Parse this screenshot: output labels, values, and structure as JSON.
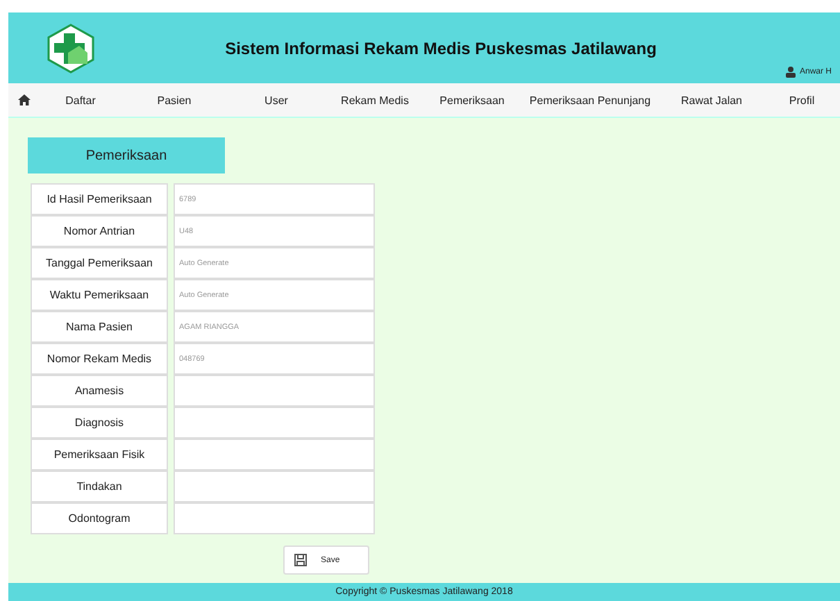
{
  "header": {
    "title": "Sistem Informasi Rekam Medis Puskesmas Jatilawang",
    "user": "Anwar H"
  },
  "nav": [
    "Daftar",
    "Pasien",
    "User",
    "Rekam Medis",
    "Pemeriksaan",
    "Pemeriksaan Penunjang",
    "Rawat Jalan",
    "Profil"
  ],
  "form": {
    "title": "Pemeriksaan",
    "fields": [
      {
        "label": "Id Hasil Pemeriksaan",
        "value": "6789"
      },
      {
        "label": "Nomor Antrian",
        "value": "U48"
      },
      {
        "label": "Tanggal Pemeriksaan",
        "value": "Auto Generate"
      },
      {
        "label": "Waktu Pemeriksaan",
        "value": "Auto Generate"
      },
      {
        "label": "Nama Pasien",
        "value": "AGAM RIANGGA"
      },
      {
        "label": "Nomor Rekam Medis",
        "value": "048769"
      },
      {
        "label": "Anamesis"
      },
      {
        "label": "Diagnosis"
      },
      {
        "label": "Pemeriksaan Fisik"
      },
      {
        "label": "Tindakan"
      },
      {
        "label": "Odontogram"
      }
    ],
    "save": "Save"
  },
  "footer": "Copyright © Puskesmas Jatilawang 2018"
}
